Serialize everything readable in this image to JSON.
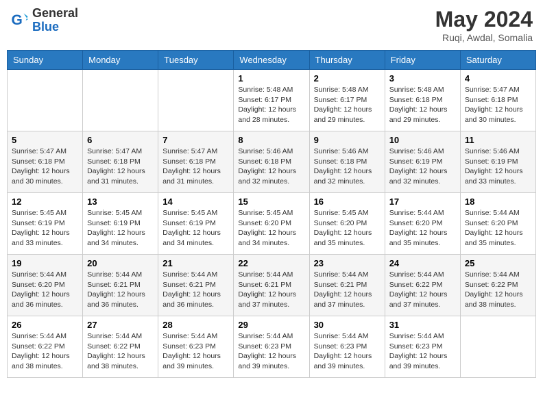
{
  "header": {
    "logo_line1": "General",
    "logo_line2": "Blue",
    "month_year": "May 2024",
    "location": "Ruqi, Awdal, Somalia"
  },
  "weekdays": [
    "Sunday",
    "Monday",
    "Tuesday",
    "Wednesday",
    "Thursday",
    "Friday",
    "Saturday"
  ],
  "weeks": [
    [
      {
        "day": "",
        "info": ""
      },
      {
        "day": "",
        "info": ""
      },
      {
        "day": "",
        "info": ""
      },
      {
        "day": "1",
        "info": "Sunrise: 5:48 AM\nSunset: 6:17 PM\nDaylight: 12 hours\nand 28 minutes."
      },
      {
        "day": "2",
        "info": "Sunrise: 5:48 AM\nSunset: 6:17 PM\nDaylight: 12 hours\nand 29 minutes."
      },
      {
        "day": "3",
        "info": "Sunrise: 5:48 AM\nSunset: 6:18 PM\nDaylight: 12 hours\nand 29 minutes."
      },
      {
        "day": "4",
        "info": "Sunrise: 5:47 AM\nSunset: 6:18 PM\nDaylight: 12 hours\nand 30 minutes."
      }
    ],
    [
      {
        "day": "5",
        "info": "Sunrise: 5:47 AM\nSunset: 6:18 PM\nDaylight: 12 hours\nand 30 minutes."
      },
      {
        "day": "6",
        "info": "Sunrise: 5:47 AM\nSunset: 6:18 PM\nDaylight: 12 hours\nand 31 minutes."
      },
      {
        "day": "7",
        "info": "Sunrise: 5:47 AM\nSunset: 6:18 PM\nDaylight: 12 hours\nand 31 minutes."
      },
      {
        "day": "8",
        "info": "Sunrise: 5:46 AM\nSunset: 6:18 PM\nDaylight: 12 hours\nand 32 minutes."
      },
      {
        "day": "9",
        "info": "Sunrise: 5:46 AM\nSunset: 6:18 PM\nDaylight: 12 hours\nand 32 minutes."
      },
      {
        "day": "10",
        "info": "Sunrise: 5:46 AM\nSunset: 6:19 PM\nDaylight: 12 hours\nand 32 minutes."
      },
      {
        "day": "11",
        "info": "Sunrise: 5:46 AM\nSunset: 6:19 PM\nDaylight: 12 hours\nand 33 minutes."
      }
    ],
    [
      {
        "day": "12",
        "info": "Sunrise: 5:45 AM\nSunset: 6:19 PM\nDaylight: 12 hours\nand 33 minutes."
      },
      {
        "day": "13",
        "info": "Sunrise: 5:45 AM\nSunset: 6:19 PM\nDaylight: 12 hours\nand 34 minutes."
      },
      {
        "day": "14",
        "info": "Sunrise: 5:45 AM\nSunset: 6:19 PM\nDaylight: 12 hours\nand 34 minutes."
      },
      {
        "day": "15",
        "info": "Sunrise: 5:45 AM\nSunset: 6:20 PM\nDaylight: 12 hours\nand 34 minutes."
      },
      {
        "day": "16",
        "info": "Sunrise: 5:45 AM\nSunset: 6:20 PM\nDaylight: 12 hours\nand 35 minutes."
      },
      {
        "day": "17",
        "info": "Sunrise: 5:44 AM\nSunset: 6:20 PM\nDaylight: 12 hours\nand 35 minutes."
      },
      {
        "day": "18",
        "info": "Sunrise: 5:44 AM\nSunset: 6:20 PM\nDaylight: 12 hours\nand 35 minutes."
      }
    ],
    [
      {
        "day": "19",
        "info": "Sunrise: 5:44 AM\nSunset: 6:20 PM\nDaylight: 12 hours\nand 36 minutes."
      },
      {
        "day": "20",
        "info": "Sunrise: 5:44 AM\nSunset: 6:21 PM\nDaylight: 12 hours\nand 36 minutes."
      },
      {
        "day": "21",
        "info": "Sunrise: 5:44 AM\nSunset: 6:21 PM\nDaylight: 12 hours\nand 36 minutes."
      },
      {
        "day": "22",
        "info": "Sunrise: 5:44 AM\nSunset: 6:21 PM\nDaylight: 12 hours\nand 37 minutes."
      },
      {
        "day": "23",
        "info": "Sunrise: 5:44 AM\nSunset: 6:21 PM\nDaylight: 12 hours\nand 37 minutes."
      },
      {
        "day": "24",
        "info": "Sunrise: 5:44 AM\nSunset: 6:22 PM\nDaylight: 12 hours\nand 37 minutes."
      },
      {
        "day": "25",
        "info": "Sunrise: 5:44 AM\nSunset: 6:22 PM\nDaylight: 12 hours\nand 38 minutes."
      }
    ],
    [
      {
        "day": "26",
        "info": "Sunrise: 5:44 AM\nSunset: 6:22 PM\nDaylight: 12 hours\nand 38 minutes."
      },
      {
        "day": "27",
        "info": "Sunrise: 5:44 AM\nSunset: 6:22 PM\nDaylight: 12 hours\nand 38 minutes."
      },
      {
        "day": "28",
        "info": "Sunrise: 5:44 AM\nSunset: 6:23 PM\nDaylight: 12 hours\nand 39 minutes."
      },
      {
        "day": "29",
        "info": "Sunrise: 5:44 AM\nSunset: 6:23 PM\nDaylight: 12 hours\nand 39 minutes."
      },
      {
        "day": "30",
        "info": "Sunrise: 5:44 AM\nSunset: 6:23 PM\nDaylight: 12 hours\nand 39 minutes."
      },
      {
        "day": "31",
        "info": "Sunrise: 5:44 AM\nSunset: 6:23 PM\nDaylight: 12 hours\nand 39 minutes."
      },
      {
        "day": "",
        "info": ""
      }
    ]
  ]
}
